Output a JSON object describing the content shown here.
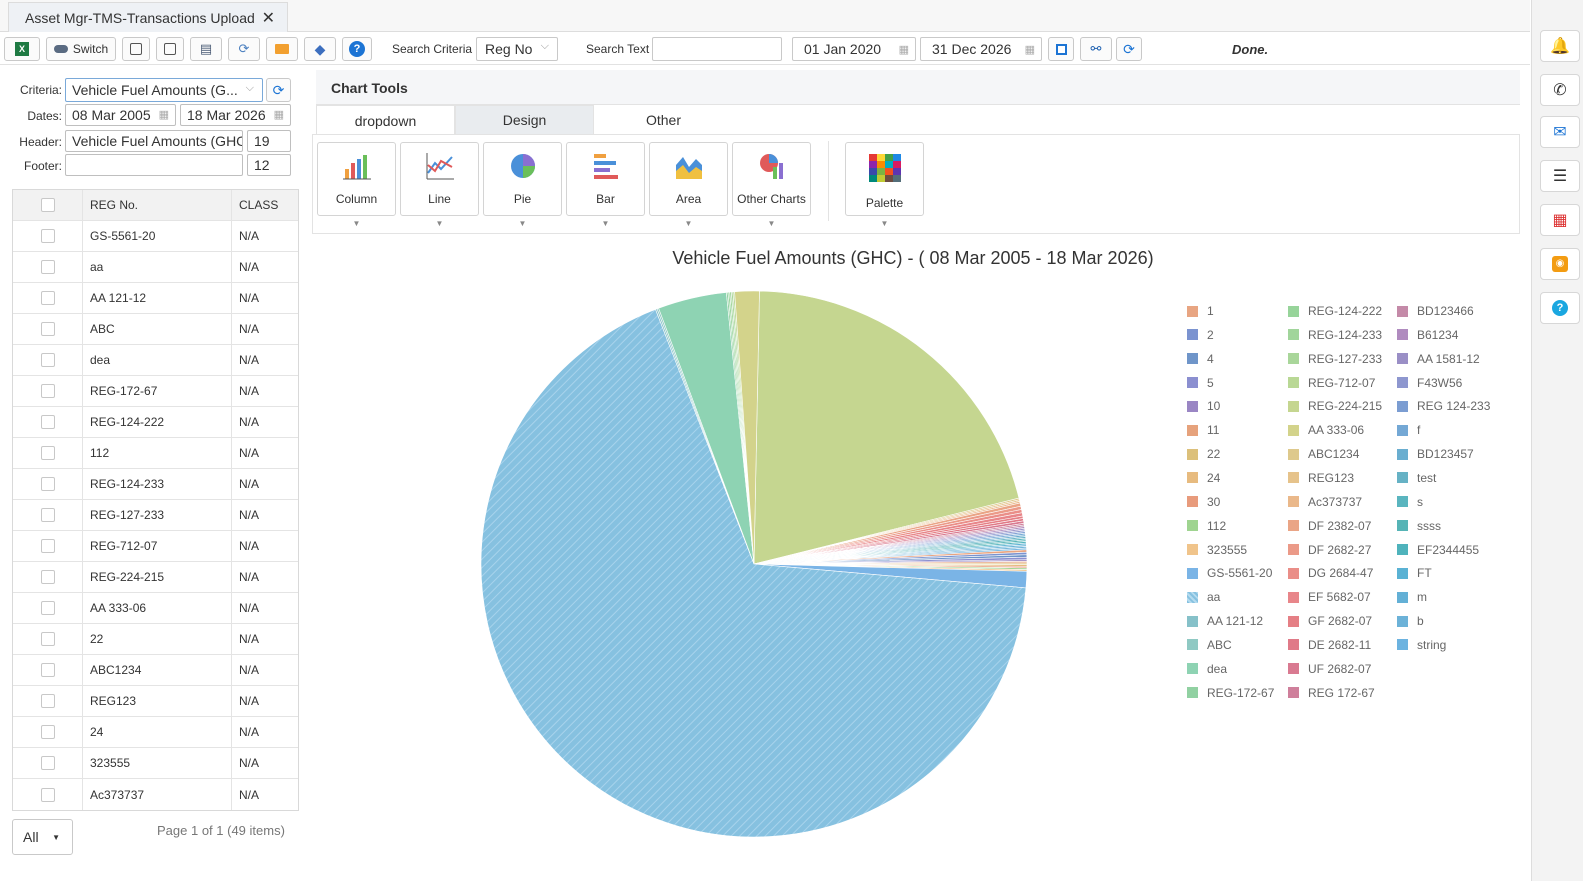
{
  "tab": {
    "title": "Asset Mgr-TMS-Transactions Upload",
    "close": "✕"
  },
  "toolbar": {
    "switch_label": "Switch",
    "search_criteria_label": "Search Criteria",
    "search_criteria_value": "Reg No",
    "search_text_label": "Search Text",
    "search_text_value": "",
    "date_from": "01 Jan 2020",
    "date_to": "31 Dec 2026",
    "status": "Done."
  },
  "filters": {
    "criteria_label": "Criteria:",
    "criteria_value": "Vehicle Fuel Amounts (G...",
    "dates_label": "Dates:",
    "date_from": "08 Mar 2005",
    "date_to": "18 Mar 2026",
    "header_label": "Header:",
    "header_value": "Vehicle Fuel Amounts (GHC",
    "header_size": "19",
    "footer_label": "Footer:",
    "footer_value": "",
    "footer_size": "12"
  },
  "grid": {
    "columns": [
      "REG No.",
      "CLASS"
    ],
    "rows": [
      [
        "GS-5561-20",
        "N/A"
      ],
      [
        "aa",
        "N/A"
      ],
      [
        "AA 121-12",
        "N/A"
      ],
      [
        "ABC",
        "N/A"
      ],
      [
        "dea",
        "N/A"
      ],
      [
        "REG-172-67",
        "N/A"
      ],
      [
        "REG-124-222",
        "N/A"
      ],
      [
        "112",
        "N/A"
      ],
      [
        "REG-124-233",
        "N/A"
      ],
      [
        "REG-127-233",
        "N/A"
      ],
      [
        "REG-712-07",
        "N/A"
      ],
      [
        "REG-224-215",
        "N/A"
      ],
      [
        "AA 333-06",
        "N/A"
      ],
      [
        "22",
        "N/A"
      ],
      [
        "ABC1234",
        "N/A"
      ],
      [
        "REG123",
        "N/A"
      ],
      [
        "24",
        "N/A"
      ],
      [
        "323555",
        "N/A"
      ],
      [
        "Ac373737",
        "N/A"
      ]
    ],
    "page_size": "All",
    "pager_text": "Page 1 of 1 (49 items)"
  },
  "chart_tools": {
    "title": "Chart Tools",
    "tabs": [
      "dropdown",
      "Design",
      "Other"
    ],
    "buttons": [
      "Column",
      "Line",
      "Pie",
      "Bar",
      "Area",
      "Other Charts"
    ],
    "palette": "Palette"
  },
  "chart_data": {
    "type": "pie",
    "title": "Vehicle Fuel Amounts (GHC) - ( 08 Mar 2005 - 18 Mar 2026)",
    "legend_position": "right",
    "labels": [
      "1",
      "2",
      "4",
      "5",
      "10",
      "11",
      "22",
      "24",
      "30",
      "112",
      "323555",
      "GS-5561-20",
      "aa",
      "AA 121-12",
      "ABC",
      "dea",
      "REG-172-67",
      "REG-124-222",
      "REG-124-233",
      "REG-127-233",
      "REG-712-07",
      "REG-224-215",
      "AA 333-06",
      "ABC1234",
      "REG123",
      "Ac373737",
      "DF 2382-07",
      "DF 2682-27",
      "DG 2684-47",
      "EF 5682-07",
      "GF 2682-07",
      "DE 2682-11",
      "UF 2682-07",
      "REG 172-67",
      "BD123466",
      "B61234",
      "AA 1581-12",
      "F43W56",
      "REG 124-233",
      "f",
      "BD123457",
      "test",
      "s",
      "ssss",
      "EF2344455",
      "FT",
      "m",
      "b",
      "string"
    ],
    "values": [
      0.15,
      0.15,
      0.15,
      0.15,
      0.1,
      0.1,
      0.1,
      0.1,
      0.1,
      0.1,
      0.1,
      1.0,
      70.0,
      0.1,
      0.1,
      4.2,
      0.1,
      0.1,
      0.1,
      0.1,
      0.1,
      0.1,
      1.5,
      0.1,
      0.1,
      0.1,
      0.2,
      0.2,
      0.2,
      0.2,
      0.15,
      0.15,
      0.15,
      0.1,
      0.1,
      0.1,
      0.1,
      0.1,
      0.1,
      0.1,
      0.1,
      0.1,
      0.1,
      0.1,
      0.1,
      0.1,
      0.1,
      0.1,
      0.1
    ],
    "big_slices": {
      "aa": 70.0,
      "dea": 4.2,
      "AA 333-06": 1.5,
      "REG-224-215": 21.5
    },
    "colors": [
      "#e8a582",
      "#7b93d0",
      "#6f95c9",
      "#8b8fd0",
      "#9a86c4",
      "#e6a27c",
      "#dcc07a",
      "#e7bb7f",
      "#e89b7c",
      "#9fd490",
      "#f0c48b",
      "#7ab4e6",
      "#86c1e0",
      "#86c1c9",
      "#8fc9c3",
      "#8ed3b3",
      "#91d1a2",
      "#97d49a",
      "#a1d59b",
      "#a9d69a",
      "#b9d895",
      "#c5d690",
      "#d3d38b",
      "#dec98c",
      "#e6c38b",
      "#eab88a",
      "#eaa586",
      "#eb9a88",
      "#ea8e88",
      "#e8868a",
      "#e57f85",
      "#e07a88",
      "#d97a91",
      "#cf7f9b",
      "#c48aa8",
      "#b08bbf",
      "#9a8fc6",
      "#8e97cf",
      "#7b9dd2",
      "#74a8d5",
      "#6aaed0",
      "#66b2c5",
      "#5ab5bf",
      "#56b4b6",
      "#4fb3bc",
      "#5ab2d4",
      "#63b0d6",
      "#6cb2d8",
      "#6cb3e0"
    ]
  },
  "legend": {
    "col1": [
      [
        "1",
        "#e8a582"
      ],
      [
        "2",
        "#7b93d0"
      ],
      [
        "4",
        "#6f95c9"
      ],
      [
        "5",
        "#8b8fd0"
      ],
      [
        "10",
        "#9a86c4"
      ],
      [
        "11",
        "#e6a27c"
      ],
      [
        "22",
        "#dcc07a"
      ],
      [
        "24",
        "#e7bb7f"
      ],
      [
        "30",
        "#e89b7c"
      ],
      [
        "112",
        "#9fd490"
      ],
      [
        "323555",
        "#f0c48b"
      ],
      [
        "GS-5561-20",
        "#7ab4e6"
      ],
      [
        "aa",
        "#86c1e0"
      ],
      [
        "AA 121-12",
        "#86c1c9"
      ],
      [
        "ABC",
        "#8fc9c3"
      ],
      [
        "dea",
        "#8ed3b3"
      ],
      [
        "REG-172-67",
        "#91d1a2"
      ]
    ],
    "col2": [
      [
        "REG-124-222",
        "#97d49a"
      ],
      [
        "REG-124-233",
        "#a1d59b"
      ],
      [
        "REG-127-233",
        "#a9d69a"
      ],
      [
        "REG-712-07",
        "#b9d895"
      ],
      [
        "REG-224-215",
        "#c5d690"
      ],
      [
        "AA 333-06",
        "#d3d38b"
      ],
      [
        "ABC1234",
        "#dec98c"
      ],
      [
        "REG123",
        "#e6c38b"
      ],
      [
        "Ac373737",
        "#eab88a"
      ],
      [
        "DF 2382-07",
        "#eaa586"
      ],
      [
        "DF 2682-27",
        "#eb9a88"
      ],
      [
        "DG 2684-47",
        "#ea8e88"
      ],
      [
        "EF 5682-07",
        "#e8868a"
      ],
      [
        "GF 2682-07",
        "#e57f85"
      ],
      [
        "DE 2682-11",
        "#e07a88"
      ],
      [
        "UF 2682-07",
        "#d97a91"
      ],
      [
        "REG 172-67",
        "#cf7f9b"
      ]
    ],
    "col3": [
      [
        "BD123466",
        "#c48aa8"
      ],
      [
        "B61234",
        "#b08bbf"
      ],
      [
        "AA 1581-12",
        "#9a8fc6"
      ],
      [
        "F43W56",
        "#8e97cf"
      ],
      [
        "REG 124-233",
        "#7b9dd2"
      ],
      [
        "f",
        "#74a8d5"
      ],
      [
        "BD123457",
        "#6aaed0"
      ],
      [
        "test",
        "#66b2c5"
      ],
      [
        "s",
        "#5ab5bf"
      ],
      [
        "ssss",
        "#56b4b6"
      ],
      [
        "EF2344455",
        "#4fb3bc"
      ],
      [
        "FT",
        "#5ab2d4"
      ],
      [
        "m",
        "#63b0d6"
      ],
      [
        "b",
        "#6cb2d8"
      ],
      [
        "string",
        "#6cb3e0"
      ]
    ]
  }
}
